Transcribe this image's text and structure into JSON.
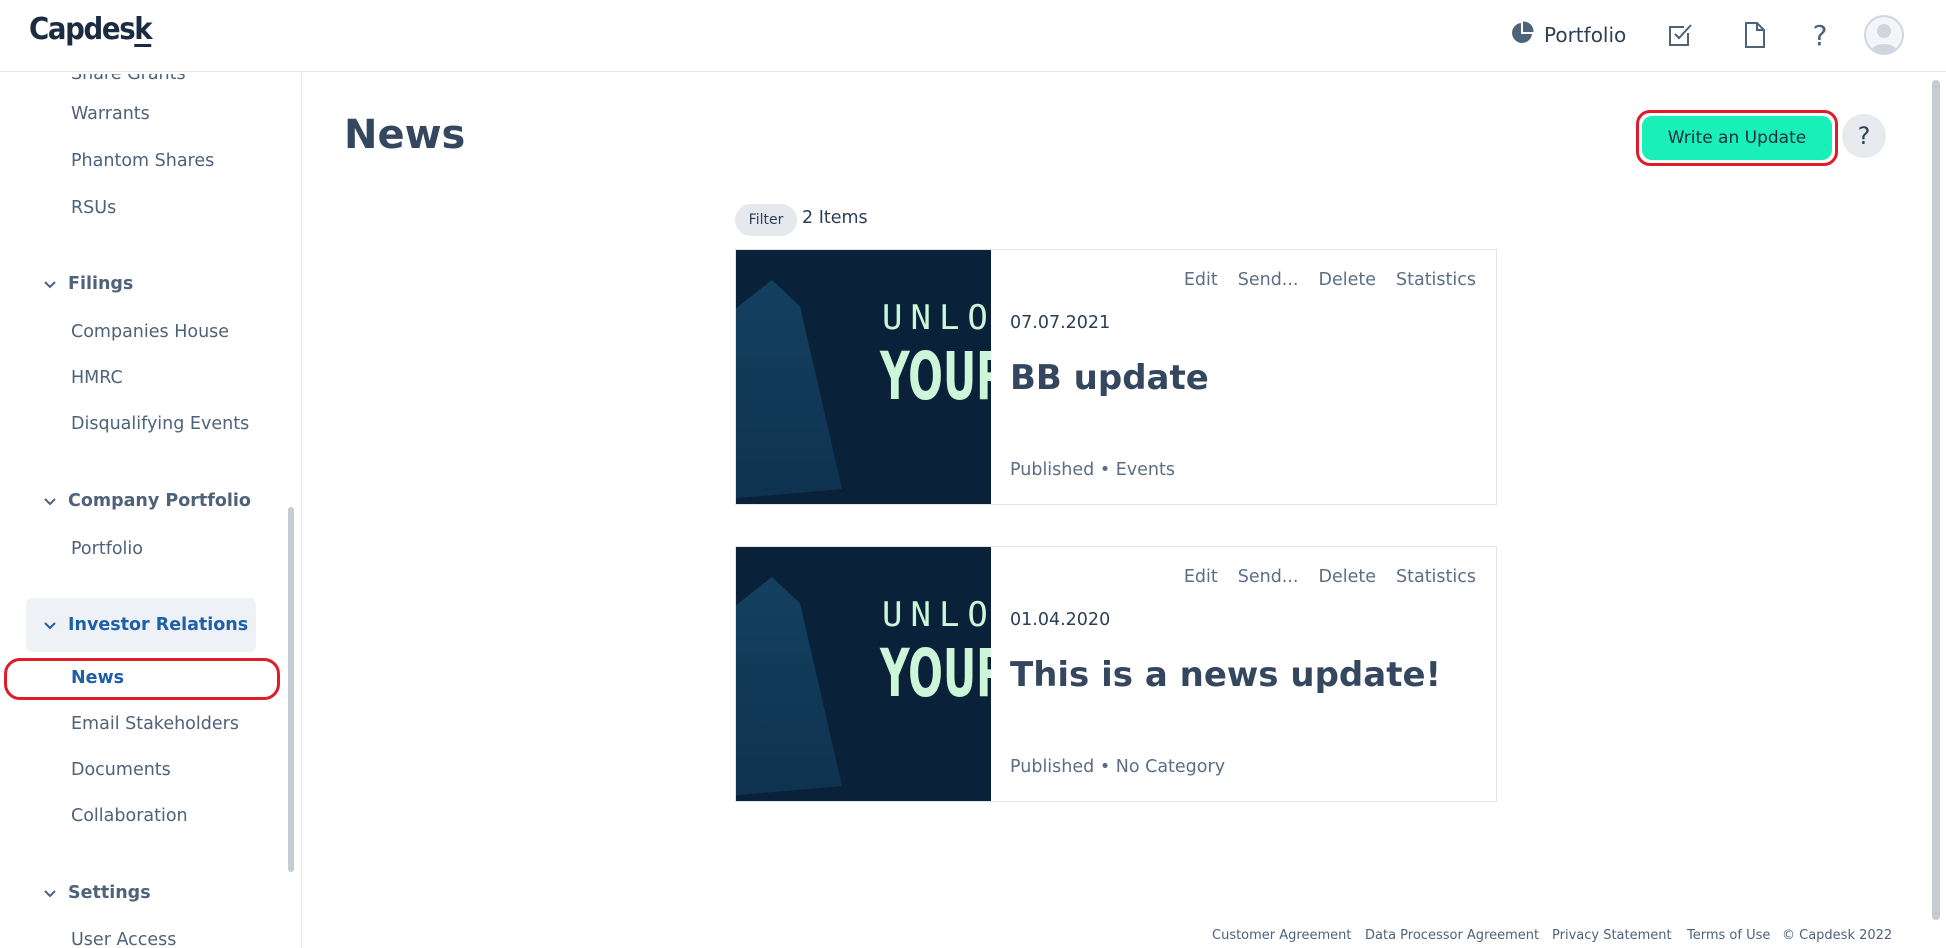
{
  "header": {
    "logo": "Capdesk",
    "portfolio_label": "Portfolio",
    "icons": [
      "pie-chart-icon",
      "checklist-icon",
      "document-icon",
      "help-icon",
      "user-avatar-icon"
    ]
  },
  "sidebar": {
    "partial_item": "Share Grants",
    "items_top": [
      "Warrants",
      "Phantom Shares",
      "RSUs"
    ],
    "sections": [
      {
        "label": "Filings",
        "items": [
          "Companies House",
          "HMRC",
          "Disqualifying Events"
        ]
      },
      {
        "label": "Company Portfolio",
        "items": [
          "Portfolio"
        ]
      },
      {
        "label": "Investor Relations",
        "items": [
          "News",
          "Email Stakeholders",
          "Documents",
          "Collaboration"
        ]
      },
      {
        "label": "Settings",
        "items": [
          "User Access"
        ]
      }
    ]
  },
  "main": {
    "title": "News",
    "write_button": "Write an Update",
    "help_label": "?",
    "filter_label": "Filter",
    "items_count": "2 Items",
    "cards": [
      {
        "date": "07.07.2021",
        "title": "BB update",
        "status": "Published",
        "separator": "•",
        "category": "Events",
        "thumb_line1": "UNLO",
        "thumb_line2": "YOUR",
        "actions": [
          "Edit",
          "Send...",
          "Delete",
          "Statistics"
        ]
      },
      {
        "date": "01.04.2020",
        "title": "This is a news update!",
        "status": "Published",
        "separator": "•",
        "category": "No Category",
        "thumb_line1": "UNLO",
        "thumb_line2": "YOUR",
        "actions": [
          "Edit",
          "Send...",
          "Delete",
          "Statistics"
        ]
      }
    ]
  },
  "footer": {
    "links": [
      "Customer Agreement",
      "Data Processor Agreement",
      "Privacy Statement",
      "Terms of Use"
    ],
    "copyright": "© Capdesk 2022"
  },
  "colors": {
    "accent": "#19f0b8",
    "active_blue": "#1f5fa8",
    "annotation_red": "#e01b2b",
    "thumb_bg": "#0a2239"
  }
}
